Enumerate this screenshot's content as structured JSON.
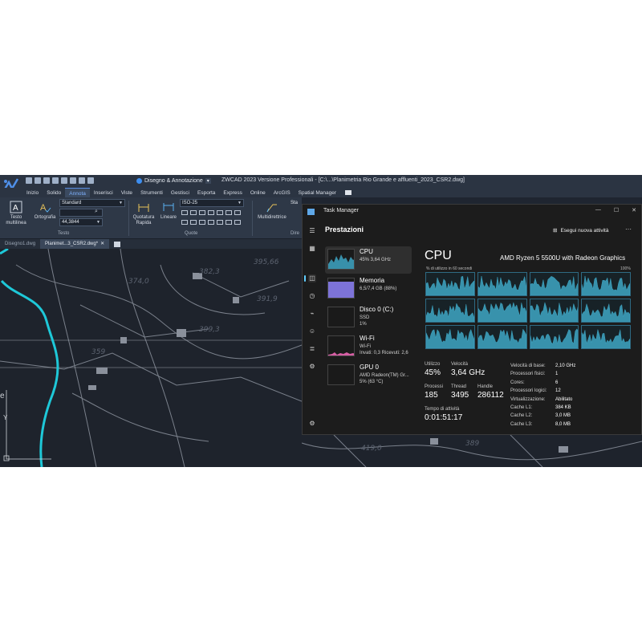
{
  "cad": {
    "workspace": "Disegno & Annotazione",
    "window_title": "ZWCAD 2023 Versione Professionali - [C:\\...\\Planimetria Rio Grande e affluenti_2023_CSR2.dwg]",
    "menu_tabs": [
      "Inizio",
      "Solido",
      "Annota",
      "Inserisci",
      "Viste",
      "Strumenti",
      "Gestisci",
      "Esporta",
      "Express",
      "Online",
      "ArcGIS",
      "Spatial Manager"
    ],
    "active_tab": "Annota",
    "ribbon": {
      "testo_multilinea": "Testo multilinea",
      "ortografia": "Ortografia",
      "text_style": "Standard",
      "text_height": "44,3844",
      "quotatura_rapida": "Quotatura Rapida",
      "lineare": "Lineare",
      "dim_style": "ISO-25",
      "multidirettrice": "Multidirettrice",
      "partial_style": "Sta",
      "panel_testo": "Testo",
      "panel_quote": "Quote",
      "panel_direttrici": "Dire"
    },
    "doc_tabs": [
      "Disegno1.dwg",
      "Planimet...3_CSR2.dwg*"
    ],
    "map_labels": [
      "395,66",
      "374,0",
      "382,3",
      "391,9",
      "399,3",
      "359",
      "419,0",
      "389"
    ],
    "axis_y": "Y",
    "edge_letter": "e"
  },
  "taskmanager": {
    "title": "Task Manager",
    "header": "Prestazioni",
    "new_task": "Esegui nuova attività",
    "window_controls": [
      "—",
      "☐",
      "✕"
    ],
    "items": [
      {
        "name": "CPU",
        "sub1": "45% 3,64 GHz",
        "sub2": ""
      },
      {
        "name": "Memoria",
        "sub1": "6,5/7,4 GB (88%)",
        "sub2": ""
      },
      {
        "name": "Disco 0 (C:)",
        "sub1": "SSD",
        "sub2": "1%"
      },
      {
        "name": "Wi-Fi",
        "sub1": "Wi-Fi",
        "sub2": "Invati: 0,3 Ricevuti: 2,6"
      },
      {
        "name": "GPU 0",
        "sub1": "AMD Radeon(TM) Gr...",
        "sub2": "5% (63 °C)"
      }
    ],
    "cpu": {
      "title": "CPU",
      "model": "AMD Ryzen 5 5500U with Radeon Graphics",
      "axis_left": "% di utilizzo in 60 secondi",
      "axis_right": "100%",
      "utilizzo_label": "Utilizzo",
      "utilizzo": "45%",
      "velocita_label": "Velocità",
      "velocita": "3,64 GHz",
      "processi_label": "Processi",
      "processi": "185",
      "thread_label": "Thread",
      "thread": "3495",
      "handle_label": "Handle",
      "handle": "286112",
      "tempo_label": "Tempo di attività",
      "tempo": "0:01:51:17",
      "specs": [
        {
          "k": "Velocità di base:",
          "v": "2,10 GHz"
        },
        {
          "k": "Processori fisici:",
          "v": "1"
        },
        {
          "k": "Cores:",
          "v": "6"
        },
        {
          "k": "Processori logici:",
          "v": "12"
        },
        {
          "k": "Virtualizzazione:",
          "v": "Abilitato"
        },
        {
          "k": "Cache L1:",
          "v": "384 KB"
        },
        {
          "k": "Cache L2:",
          "v": "3,0 MB"
        },
        {
          "k": "Cache L3:",
          "v": "8,0 MB"
        }
      ],
      "core_count": 12
    },
    "colors": {
      "cpu": "#3ea6c4",
      "memory": "#7d73d8",
      "wifi": "#d65fa4",
      "accent": "#60cdff"
    }
  }
}
